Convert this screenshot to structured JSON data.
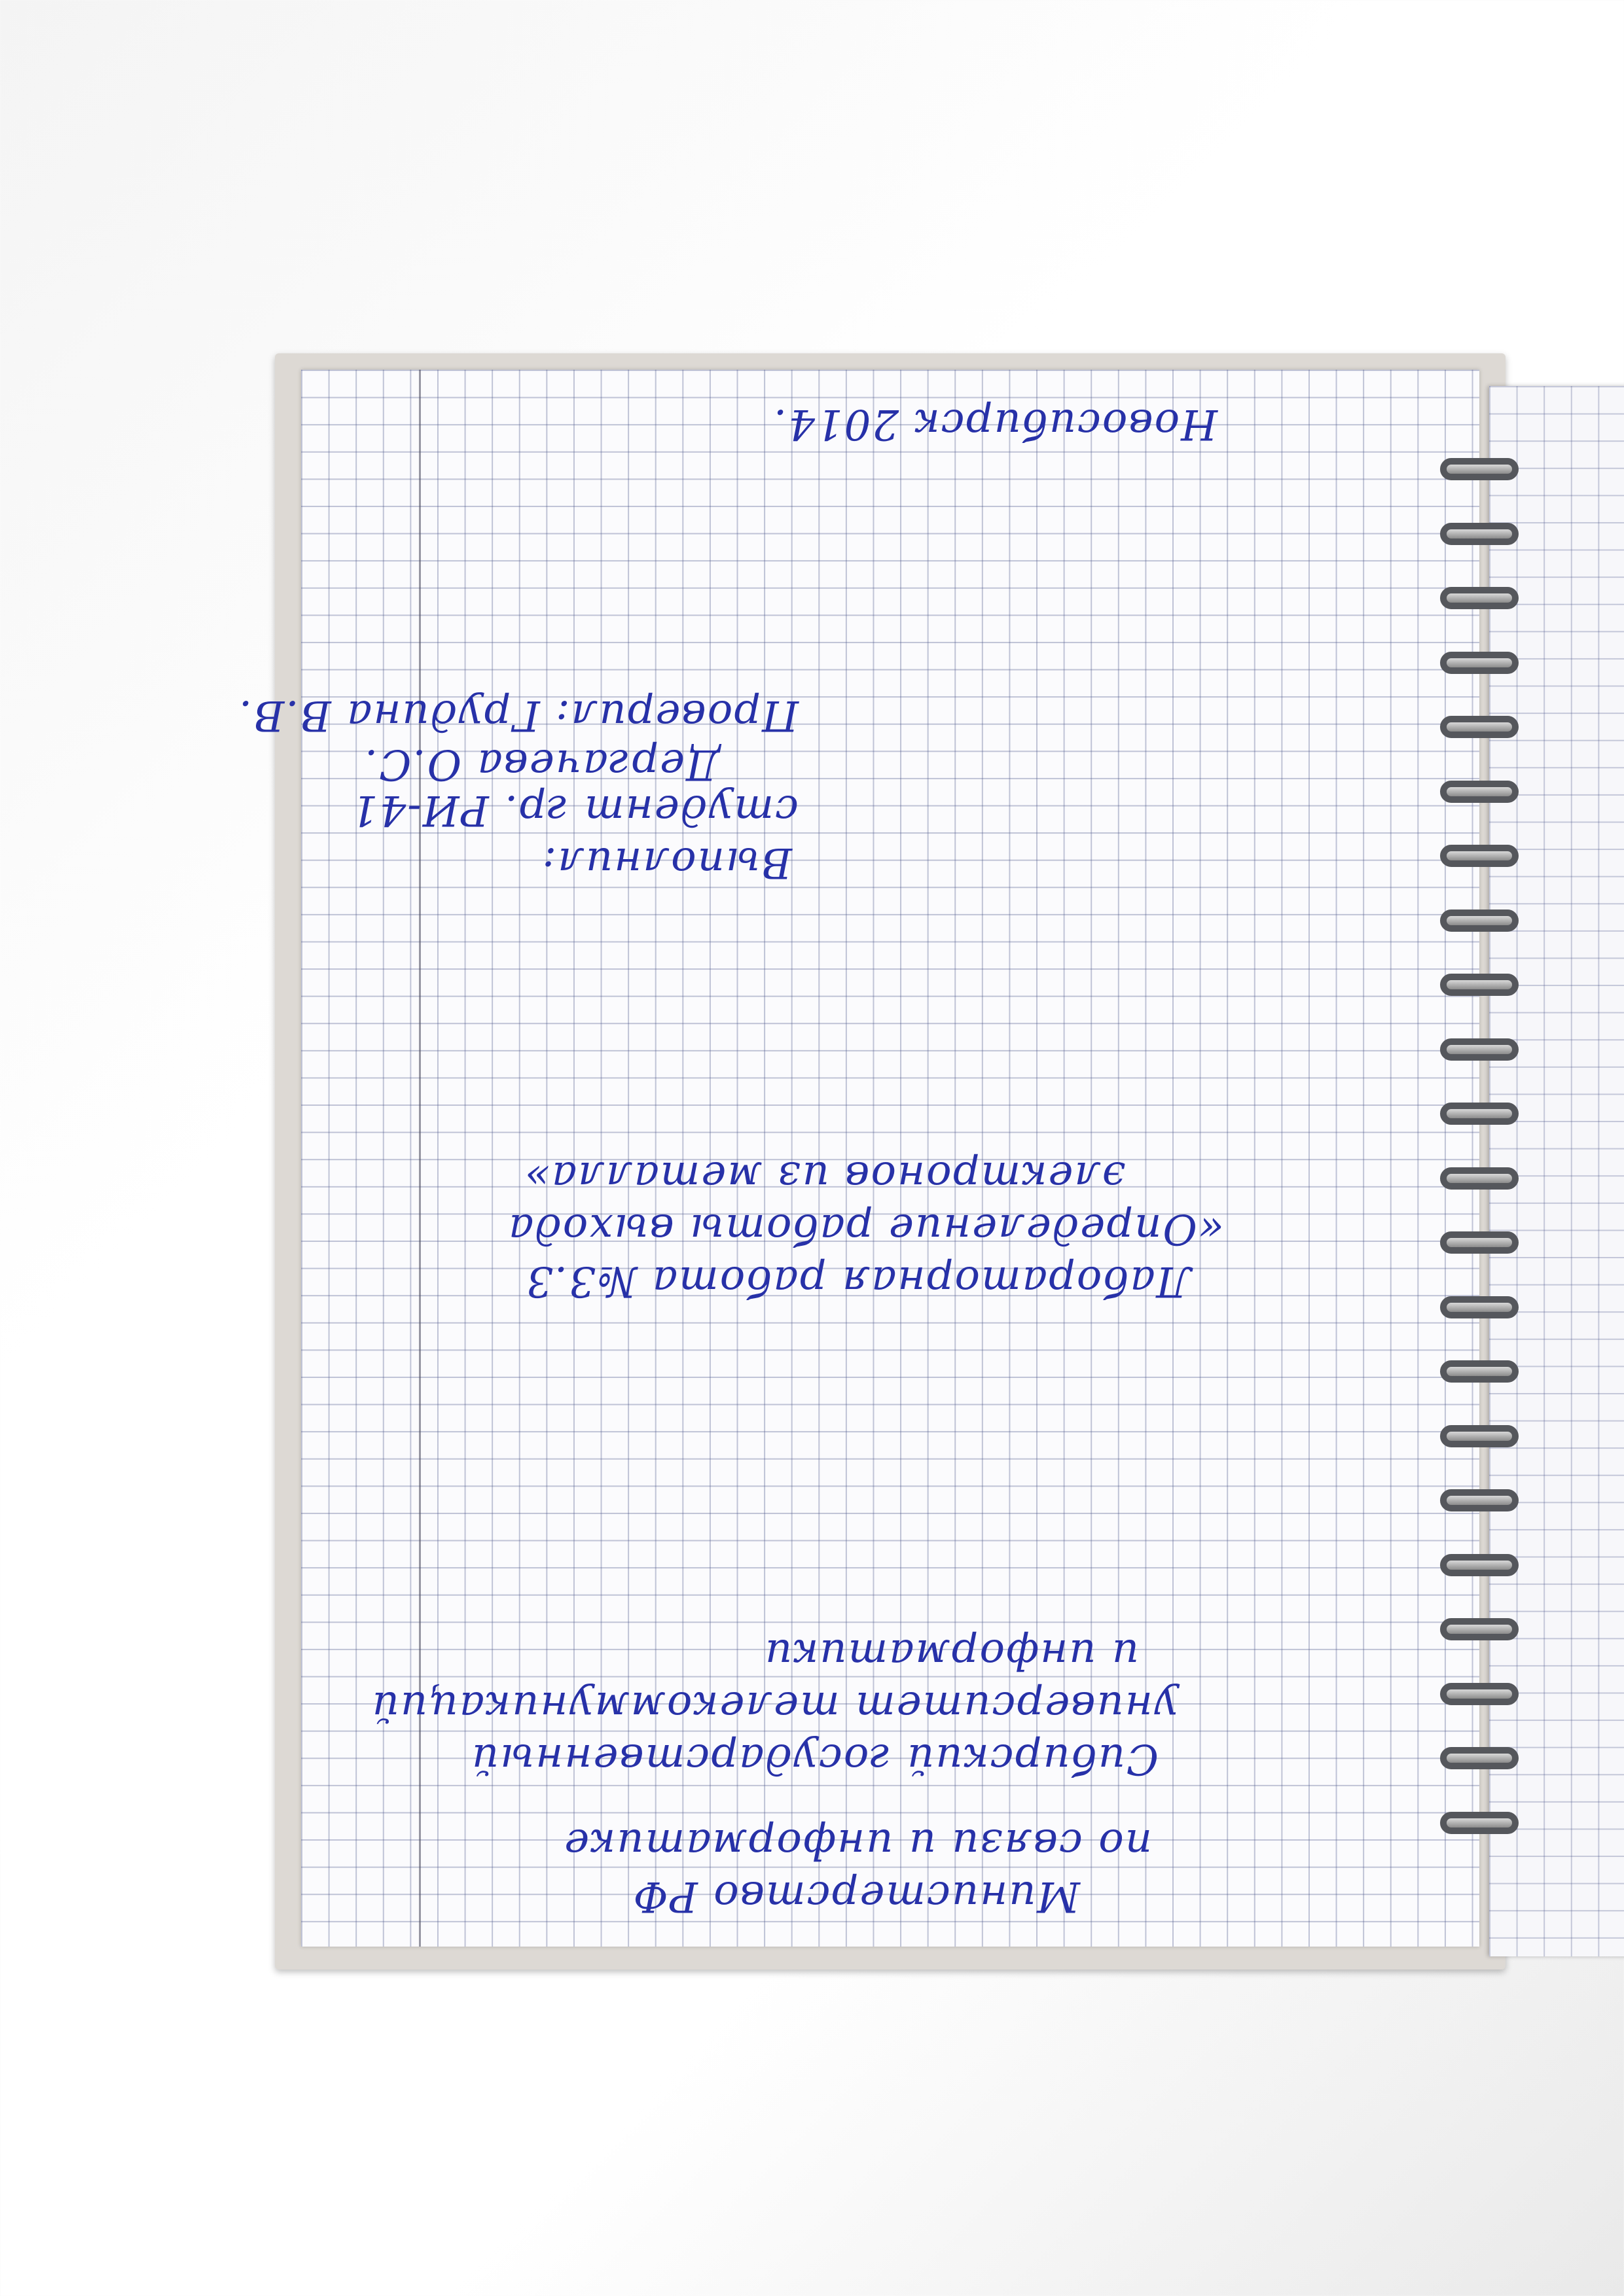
{
  "document": {
    "ministry": "Министерство РФ",
    "ministry_cont": "по связи и информатике",
    "university_1": "Сибирский государственный",
    "university_2": "университет телекоммуникаций",
    "university_3": "и информатики",
    "lab_title": "Лабораторная работа №3.3",
    "lab_subject_1": "«Определение работы выхода",
    "lab_subject_2": "электронов из металла»",
    "performed_label": "Выполнил:",
    "student_line": "студент гр. РИ-41",
    "student_name": "Дергачева О.С.",
    "checked_line": "Проверил: Грудина В.В.",
    "city_year": "Новосибирск 2014."
  },
  "colors": {
    "ink": "#2731a8",
    "paper": "#fbfbfd",
    "grid": "#5a648c"
  }
}
